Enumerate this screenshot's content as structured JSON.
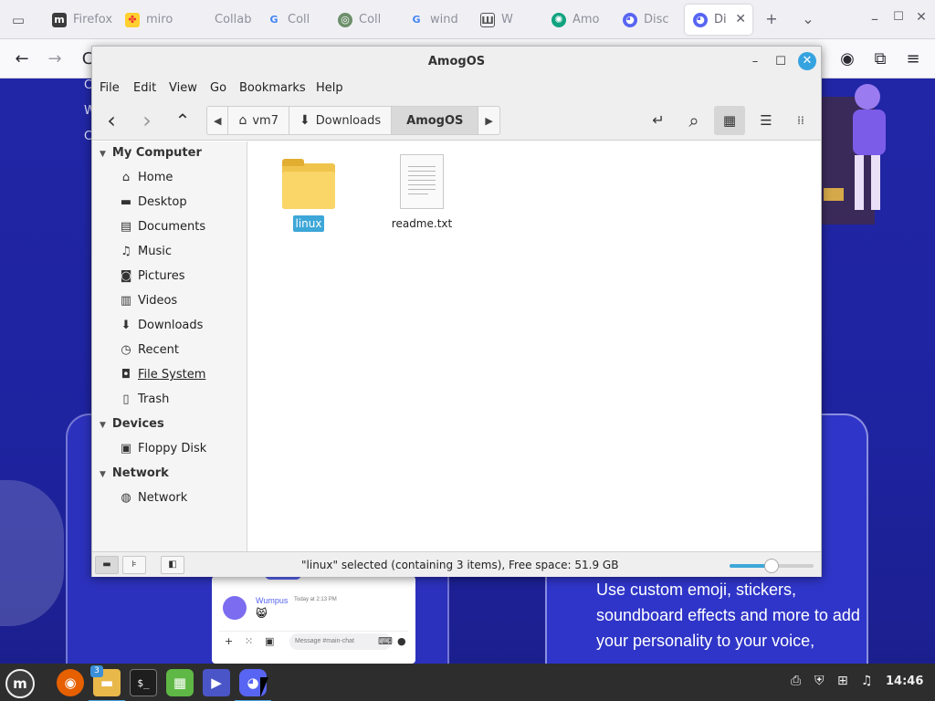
{
  "browser": {
    "tabs": [
      {
        "label": "Firefox",
        "favicon": "m-icon",
        "color": "#3b3b3b"
      },
      {
        "label": "miro",
        "favicon": "miro-icon",
        "color": "#ffd02f"
      },
      {
        "label": "Collab",
        "favicon": "blank-icon",
        "color": "#cfcfd8"
      },
      {
        "label": "Coll",
        "favicon": "google-icon",
        "color": "#4285f4"
      },
      {
        "label": "Coll",
        "favicon": "wiki-icon",
        "color": "#6d8f6b"
      },
      {
        "label": "wind",
        "favicon": "google-icon",
        "color": "#4285f4"
      },
      {
        "label": "W",
        "favicon": "book-icon",
        "color": "#555555"
      },
      {
        "label": "Amo",
        "favicon": "chatgpt-icon",
        "color": "#10a37f"
      },
      {
        "label": "Disc",
        "favicon": "discord-icon",
        "color": "#5865f2"
      },
      {
        "label": "Di",
        "favicon": "discord-icon",
        "color": "#5865f2"
      }
    ],
    "tab_close_glyph": "✕",
    "new_tab_glyph": "+",
    "list_tabs_glyph": "⌄",
    "minimize_glyph": "–",
    "maximize_glyph": "☐",
    "close_glyph": "✕",
    "back_glyph": "←",
    "forward_glyph": "→",
    "reload_glyph": "C"
  },
  "webpage": {
    "side_links": [
      "C",
      "W",
      "C"
    ],
    "promo_text": "Use custom emoji, stickers, soundboard effects and more to add your personality to your voice,",
    "chat": {
      "user": "Wumpus",
      "time": "Today at 2:13 PM",
      "emoji": "😸",
      "input_placeholder": "Message #main-chat"
    }
  },
  "window": {
    "title": "AmogOS",
    "minimize": "–",
    "maximize": "☐",
    "close": "✕"
  },
  "menu": [
    "File",
    "Edit",
    "View",
    "Go",
    "Bookmarks",
    "Help"
  ],
  "toolbar": {
    "back": "‹",
    "forward": "›",
    "up": "⌃",
    "crumb_left": "◀",
    "crumb_right": "▶",
    "crumbs": [
      {
        "label": "vm7",
        "icon": "home-icon",
        "glyph": "⌂"
      },
      {
        "label": "Downloads",
        "icon": "download-icon",
        "glyph": "⬇"
      },
      {
        "label": "AmogOS",
        "icon": "",
        "glyph": ""
      }
    ],
    "toggle_location": "↵",
    "search": "⌕",
    "view_icons": "▦",
    "view_list": "☰",
    "view_compact": "⁞⁞"
  },
  "sidebar": {
    "sections": [
      {
        "label": "My Computer",
        "items": [
          {
            "label": "Home",
            "icon": "home-icon",
            "glyph": "⌂"
          },
          {
            "label": "Desktop",
            "icon": "desktop-icon",
            "glyph": "▬"
          },
          {
            "label": "Documents",
            "icon": "document-icon",
            "glyph": "▤"
          },
          {
            "label": "Music",
            "icon": "music-icon",
            "glyph": "♫"
          },
          {
            "label": "Pictures",
            "icon": "camera-icon",
            "glyph": "◙"
          },
          {
            "label": "Videos",
            "icon": "film-icon",
            "glyph": "▥"
          },
          {
            "label": "Downloads",
            "icon": "download-icon",
            "glyph": "⬇"
          },
          {
            "label": "Recent",
            "icon": "clock-icon",
            "glyph": "◷"
          },
          {
            "label": "File System",
            "icon": "drive-icon",
            "glyph": "◘"
          },
          {
            "label": "Trash",
            "icon": "trash-icon",
            "glyph": "🗑"
          }
        ]
      },
      {
        "label": "Devices",
        "items": [
          {
            "label": "Floppy Disk",
            "icon": "floppy-icon",
            "glyph": "▣"
          }
        ]
      },
      {
        "label": "Network",
        "items": [
          {
            "label": "Network",
            "icon": "globe-icon",
            "glyph": "◍"
          }
        ]
      }
    ]
  },
  "files": [
    {
      "name": "linux",
      "type": "folder",
      "selected": true
    },
    {
      "name": "readme.txt",
      "type": "text",
      "selected": false
    }
  ],
  "status": {
    "text": "\"linux\" selected (containing 3 items), Free space: 51.9 GB",
    "zoom_fraction": 0.5,
    "btn_places": "▬",
    "btn_tree": "⊧",
    "btn_hide": "◧"
  },
  "taskbar": {
    "apps": [
      {
        "name": "mint-menu",
        "glyph": "m",
        "color": "#3c3c3c"
      },
      {
        "name": "firefox",
        "glyph": "◉",
        "color": "#e66000"
      },
      {
        "name": "files",
        "glyph": "▬",
        "color": "#e9b84a"
      },
      {
        "name": "terminal",
        "glyph": "$_",
        "color": "#1e1e1e"
      },
      {
        "name": "calc",
        "glyph": "▦",
        "color": "#5fb845"
      },
      {
        "name": "media",
        "glyph": "▶",
        "color": "#4a55c8"
      },
      {
        "name": "discord",
        "glyph": "◕",
        "color": "#5865f2"
      }
    ],
    "badge": "3",
    "tray": [
      "⎙",
      "⛨",
      "⊞",
      "♫"
    ],
    "clock": "14:46"
  }
}
